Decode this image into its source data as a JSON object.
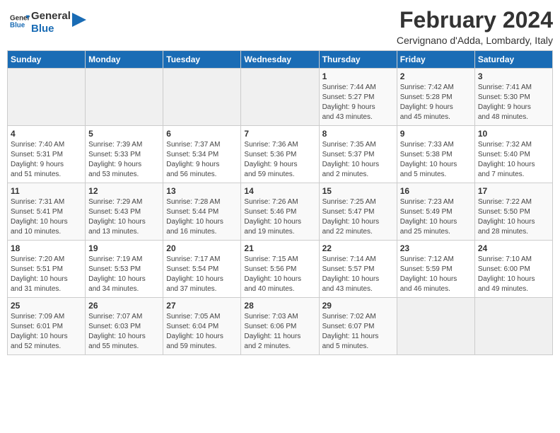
{
  "logo": {
    "line1": "General",
    "line2": "Blue"
  },
  "title": "February 2024",
  "subtitle": "Cervignano d'Adda, Lombardy, Italy",
  "days_of_week": [
    "Sunday",
    "Monday",
    "Tuesday",
    "Wednesday",
    "Thursday",
    "Friday",
    "Saturday"
  ],
  "weeks": [
    [
      {
        "day": "",
        "detail": ""
      },
      {
        "day": "",
        "detail": ""
      },
      {
        "day": "",
        "detail": ""
      },
      {
        "day": "",
        "detail": ""
      },
      {
        "day": "1",
        "detail": "Sunrise: 7:44 AM\nSunset: 5:27 PM\nDaylight: 9 hours\nand 43 minutes."
      },
      {
        "day": "2",
        "detail": "Sunrise: 7:42 AM\nSunset: 5:28 PM\nDaylight: 9 hours\nand 45 minutes."
      },
      {
        "day": "3",
        "detail": "Sunrise: 7:41 AM\nSunset: 5:30 PM\nDaylight: 9 hours\nand 48 minutes."
      }
    ],
    [
      {
        "day": "4",
        "detail": "Sunrise: 7:40 AM\nSunset: 5:31 PM\nDaylight: 9 hours\nand 51 minutes."
      },
      {
        "day": "5",
        "detail": "Sunrise: 7:39 AM\nSunset: 5:33 PM\nDaylight: 9 hours\nand 53 minutes."
      },
      {
        "day": "6",
        "detail": "Sunrise: 7:37 AM\nSunset: 5:34 PM\nDaylight: 9 hours\nand 56 minutes."
      },
      {
        "day": "7",
        "detail": "Sunrise: 7:36 AM\nSunset: 5:36 PM\nDaylight: 9 hours\nand 59 minutes."
      },
      {
        "day": "8",
        "detail": "Sunrise: 7:35 AM\nSunset: 5:37 PM\nDaylight: 10 hours\nand 2 minutes."
      },
      {
        "day": "9",
        "detail": "Sunrise: 7:33 AM\nSunset: 5:38 PM\nDaylight: 10 hours\nand 5 minutes."
      },
      {
        "day": "10",
        "detail": "Sunrise: 7:32 AM\nSunset: 5:40 PM\nDaylight: 10 hours\nand 7 minutes."
      }
    ],
    [
      {
        "day": "11",
        "detail": "Sunrise: 7:31 AM\nSunset: 5:41 PM\nDaylight: 10 hours\nand 10 minutes."
      },
      {
        "day": "12",
        "detail": "Sunrise: 7:29 AM\nSunset: 5:43 PM\nDaylight: 10 hours\nand 13 minutes."
      },
      {
        "day": "13",
        "detail": "Sunrise: 7:28 AM\nSunset: 5:44 PM\nDaylight: 10 hours\nand 16 minutes."
      },
      {
        "day": "14",
        "detail": "Sunrise: 7:26 AM\nSunset: 5:46 PM\nDaylight: 10 hours\nand 19 minutes."
      },
      {
        "day": "15",
        "detail": "Sunrise: 7:25 AM\nSunset: 5:47 PM\nDaylight: 10 hours\nand 22 minutes."
      },
      {
        "day": "16",
        "detail": "Sunrise: 7:23 AM\nSunset: 5:49 PM\nDaylight: 10 hours\nand 25 minutes."
      },
      {
        "day": "17",
        "detail": "Sunrise: 7:22 AM\nSunset: 5:50 PM\nDaylight: 10 hours\nand 28 minutes."
      }
    ],
    [
      {
        "day": "18",
        "detail": "Sunrise: 7:20 AM\nSunset: 5:51 PM\nDaylight: 10 hours\nand 31 minutes."
      },
      {
        "day": "19",
        "detail": "Sunrise: 7:19 AM\nSunset: 5:53 PM\nDaylight: 10 hours\nand 34 minutes."
      },
      {
        "day": "20",
        "detail": "Sunrise: 7:17 AM\nSunset: 5:54 PM\nDaylight: 10 hours\nand 37 minutes."
      },
      {
        "day": "21",
        "detail": "Sunrise: 7:15 AM\nSunset: 5:56 PM\nDaylight: 10 hours\nand 40 minutes."
      },
      {
        "day": "22",
        "detail": "Sunrise: 7:14 AM\nSunset: 5:57 PM\nDaylight: 10 hours\nand 43 minutes."
      },
      {
        "day": "23",
        "detail": "Sunrise: 7:12 AM\nSunset: 5:59 PM\nDaylight: 10 hours\nand 46 minutes."
      },
      {
        "day": "24",
        "detail": "Sunrise: 7:10 AM\nSunset: 6:00 PM\nDaylight: 10 hours\nand 49 minutes."
      }
    ],
    [
      {
        "day": "25",
        "detail": "Sunrise: 7:09 AM\nSunset: 6:01 PM\nDaylight: 10 hours\nand 52 minutes."
      },
      {
        "day": "26",
        "detail": "Sunrise: 7:07 AM\nSunset: 6:03 PM\nDaylight: 10 hours\nand 55 minutes."
      },
      {
        "day": "27",
        "detail": "Sunrise: 7:05 AM\nSunset: 6:04 PM\nDaylight: 10 hours\nand 59 minutes."
      },
      {
        "day": "28",
        "detail": "Sunrise: 7:03 AM\nSunset: 6:06 PM\nDaylight: 11 hours\nand 2 minutes."
      },
      {
        "day": "29",
        "detail": "Sunrise: 7:02 AM\nSunset: 6:07 PM\nDaylight: 11 hours\nand 5 minutes."
      },
      {
        "day": "",
        "detail": ""
      },
      {
        "day": "",
        "detail": ""
      }
    ]
  ]
}
